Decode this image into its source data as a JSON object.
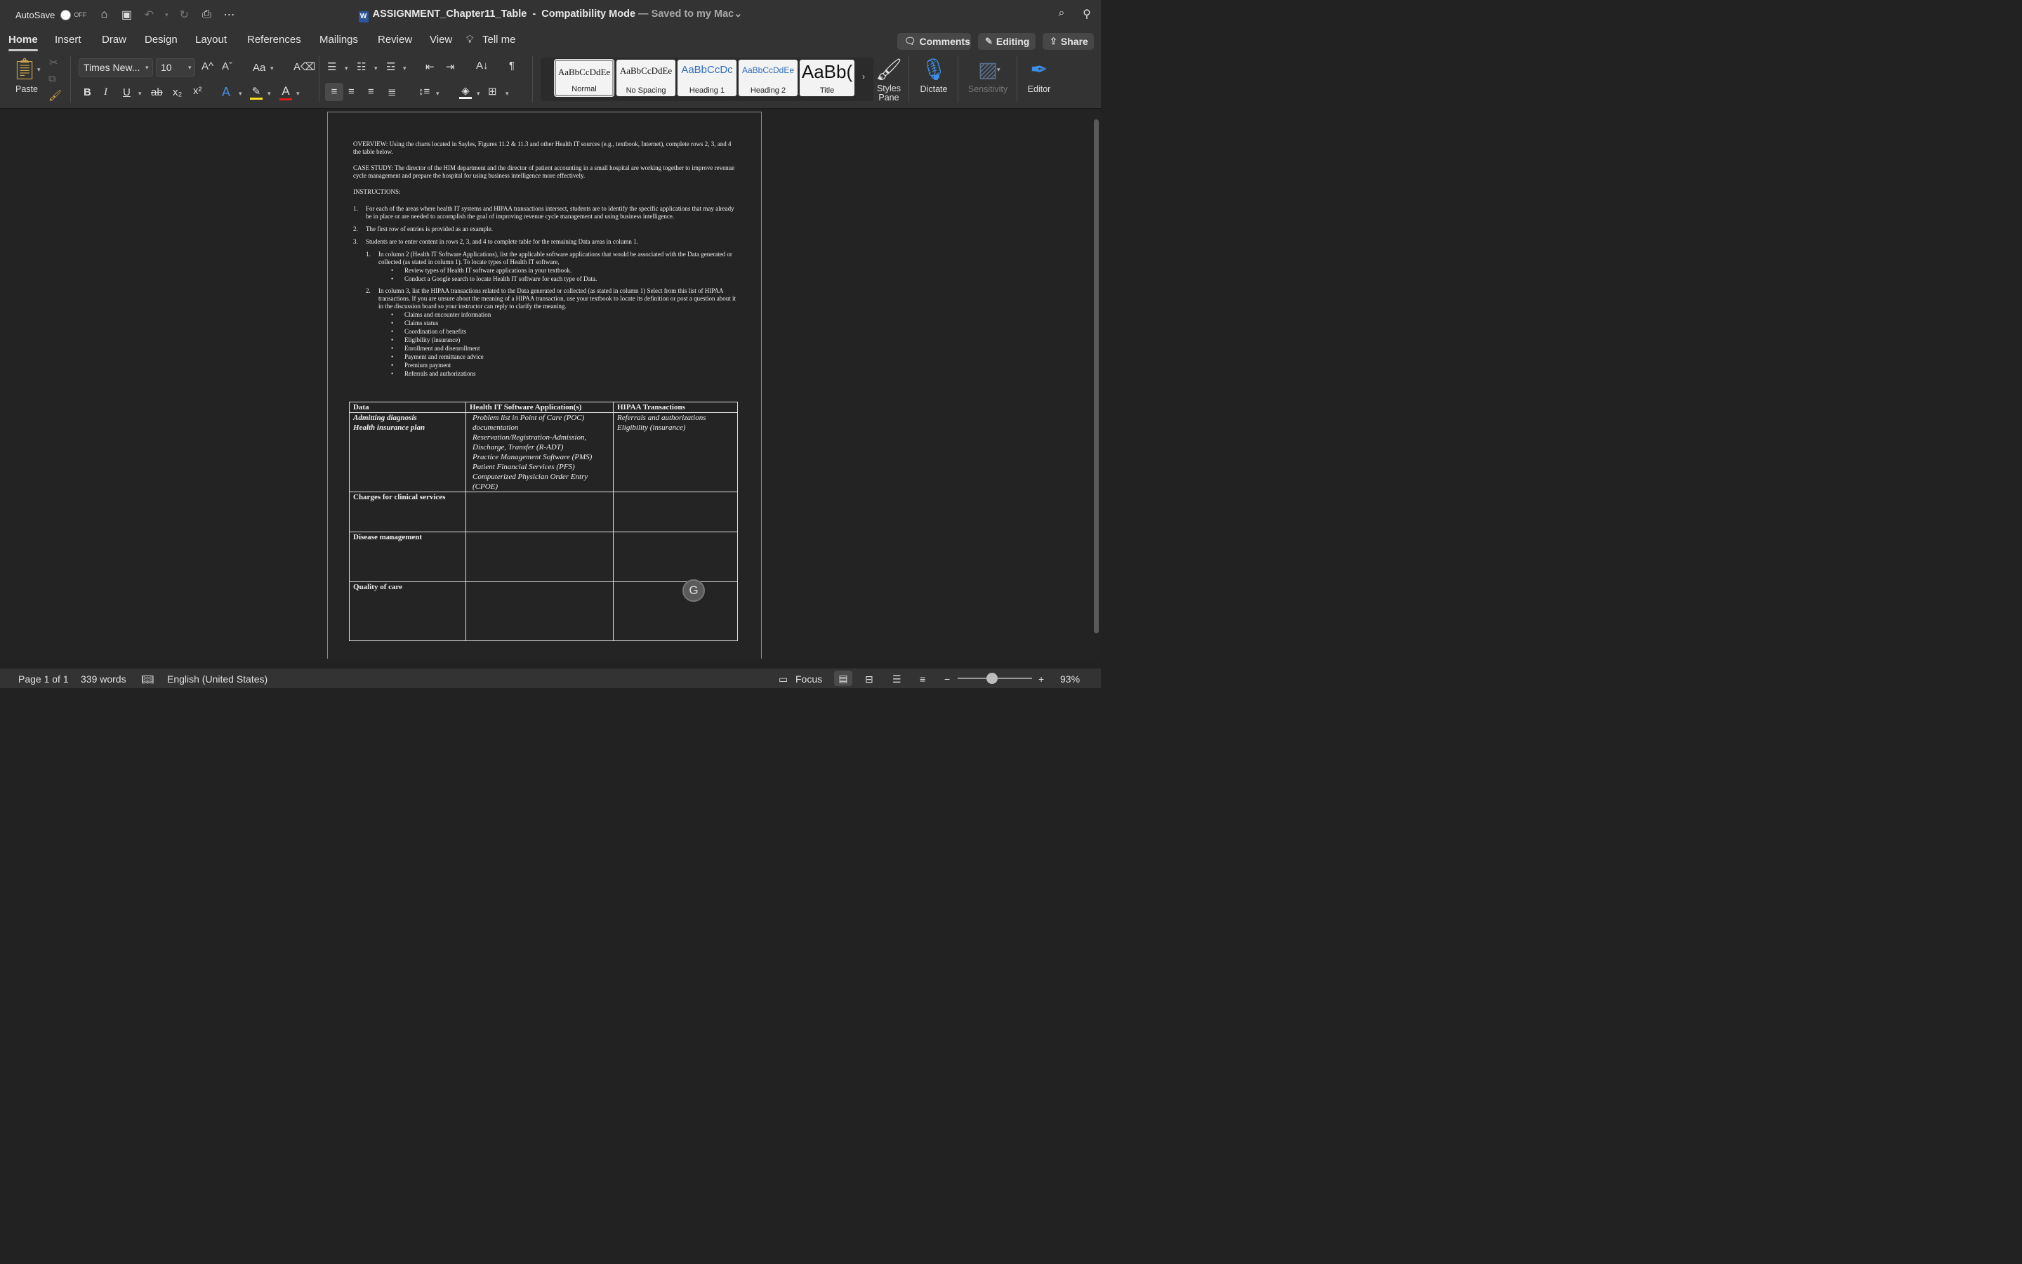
{
  "titlebar": {
    "autosave_label": "AutoSave",
    "autosave_state": "OFF",
    "doc_name": "ASSIGNMENT_Chapter11_Table",
    "mode": "Compatibility Mode",
    "saved_status": "— Saved to my Mac"
  },
  "tabs": [
    "Home",
    "Insert",
    "Draw",
    "Design",
    "Layout",
    "References",
    "Mailings",
    "Review",
    "View",
    "Tell me"
  ],
  "ribbon_buttons": {
    "comments": "Comments",
    "editing": "Editing",
    "share": "Share"
  },
  "ribbon": {
    "paste_label": "Paste",
    "font_name": "Times New...",
    "font_size": "10",
    "styles": [
      {
        "sample": "AaBbCcDdEe",
        "name": "Normal"
      },
      {
        "sample": "AaBbCcDdEe",
        "name": "No Spacing"
      },
      {
        "sample": "AaBbCcDc",
        "name": "Heading 1"
      },
      {
        "sample": "AaBbCcDdEe",
        "name": "Heading 2"
      },
      {
        "sample": "AaBb(",
        "name": "Title"
      }
    ],
    "styles_pane": "Styles Pane",
    "dictate": "Dictate",
    "sensitivity": "Sensitivity",
    "editor": "Editor"
  },
  "document": {
    "overview": "OVERVIEW: Using the charts located in Sayles, Figures 11.2 & 11.3 and other Health IT sources (e.g., textbook, Internet), complete rows 2, 3, and 4 the table below.",
    "case_study": "CASE STUDY: The director of the HIM department and the director of patient accounting in a small hospital are working together to improve revenue cycle management and prepare the hospital for using business intelligence more effectively.",
    "instructions_heading": "INSTRUCTIONS:",
    "items": [
      "For each of the areas where health IT systems and HIPAA transactions intersect, students are to identify the specific applications that may already be in place or are needed to accomplish the goal of improving revenue cycle management and using business intelligence.",
      "The first row of entries is provided as an example.",
      "Students are to enter content in rows 2, 3, and 4 to complete table for the remaining Data areas in column 1."
    ],
    "sub1": "In column 2 (Health IT Software Applications), list the applicable software applications that would be associated with the Data generated or collected (as stated in column 1). To locate types of Health IT software,",
    "sub1_bullets": [
      "Review types of Health IT software applications in your textbook.",
      "Conduct a Google search to locate Health IT software for each type of Data."
    ],
    "sub2": "In column 3, list the HIPAA transactions related to the Data generated or collected (as stated in column 1) Select from this list of HIPAA transactions. If you are unsure about the meaning of a HIPAA transaction, use your textbook to locate its definition or post a question about it in the discussion board so your instructor can reply to clarify the meaning.",
    "sub2_bullets": [
      "Claims and encounter information",
      "Claims status",
      "Coordination of benefits",
      "Eligibility (insurance)",
      "Enrollment and disenrollment",
      "Payment and remittance advice",
      "Premium payment",
      "Referrals and authorizations"
    ],
    "table": {
      "headers": [
        "Data",
        "Health IT Software Application(s)",
        "HIPAA Transactions"
      ],
      "row1_data": [
        "Admitting diagnosis",
        "Health insurance plan"
      ],
      "row1_apps": [
        "Problem list in Point of Care (POC) documentation",
        "Reservation/Registration-Admission, Discharge, Transfer (R-ADT)",
        "Practice Management Software (PMS)",
        "Patient Financial Services (PFS)",
        "Computerized Physician Order Entry (CPOE)"
      ],
      "row1_hipaa": [
        "Referrals and authorizations",
        "Eligibility (insurance)"
      ],
      "row2": "Charges for clinical services",
      "row3": "Disease management",
      "row4": "Quality of care"
    }
  },
  "status": {
    "page": "Page 1 of 1",
    "words": "339 words",
    "language": "English (United States)",
    "focus": "Focus",
    "zoom": "93%"
  }
}
